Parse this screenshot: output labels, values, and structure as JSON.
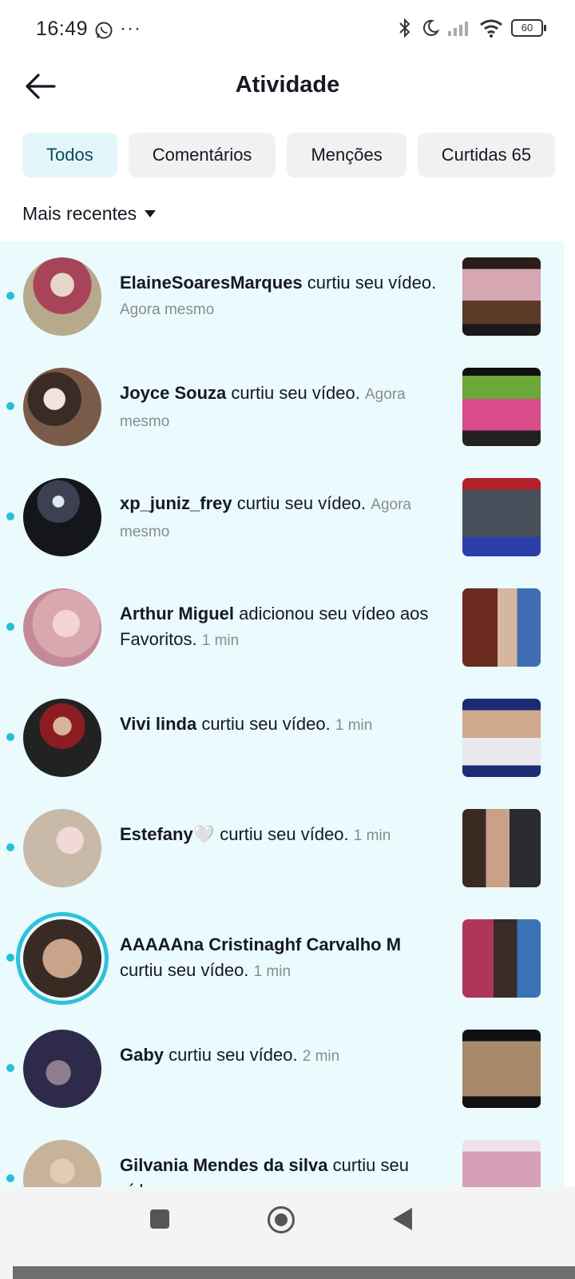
{
  "status_bar": {
    "time": "16:49",
    "more": "···",
    "battery": "60",
    "icons": [
      "whatsapp-icon",
      "bluetooth-icon",
      "moon-icon",
      "signal-icon",
      "wifi-icon",
      "battery-icon"
    ]
  },
  "header": {
    "title": "Atividade",
    "back_icon": "arrow-left-icon"
  },
  "tabs": [
    {
      "label": "Todos",
      "count": ""
    },
    {
      "label": "Comentários",
      "count": ""
    },
    {
      "label": "Menções",
      "count": ""
    },
    {
      "label": "Curtidas",
      "count": "65"
    }
  ],
  "sort": {
    "label": "Mais recentes"
  },
  "notifications": [
    {
      "name": "ElaineSoaresMarques",
      "action": "curtiu seu vídeo.",
      "time": "Agora mesmo",
      "avatar_color": "#b7a98c",
      "thumb_color": "#6b4a3a"
    },
    {
      "name": "Joyce Souza",
      "action": "curtiu seu vídeo.",
      "time": "Agora mesmo",
      "avatar_color": "#5a4b3e",
      "thumb_color": "#4e8a2a"
    },
    {
      "name": "xp_juniz_frey",
      "action": "curtiu seu vídeo.",
      "time": "Agora mesmo",
      "avatar_color": "#1d1f26",
      "thumb_color": "#3a3f6b"
    },
    {
      "name": "Arthur Miguel",
      "action": "adicionou seu vídeo aos Favoritos.",
      "time": "1 min",
      "avatar_color": "#d9a7b0",
      "thumb_color": "#b85a3a"
    },
    {
      "name": "Vivi linda",
      "action": "curtiu seu vídeo.",
      "time": "1 min",
      "avatar_color": "#3a2a24",
      "thumb_color": "#1f2f6a"
    },
    {
      "name": "Estefany🤍",
      "action": "curtiu seu vídeo.",
      "time": "1 min",
      "avatar_color": "#c9b9a8",
      "thumb_color": "#4a3a34"
    },
    {
      "name": "AAAAAna Cristinaghf Carvalho M",
      "action": "curtiu seu vídeo.",
      "time": "1 min",
      "avatar_color": "#c4a48c",
      "thumb_color": "#b0355a"
    },
    {
      "name": "Gaby",
      "action": "curtiu seu vídeo.",
      "time": "2 min",
      "avatar_color": "#2e2b4a",
      "thumb_color": "#6a4a3a"
    },
    {
      "name": "Gilvania Mendes da silva",
      "action": "curtiu seu vídeo.",
      "time": "",
      "avatar_color": "#c7b29a",
      "thumb_color": "#d6a0b6"
    }
  ],
  "nav": {
    "icons": [
      "recents-icon",
      "home-icon",
      "back-icon"
    ]
  }
}
